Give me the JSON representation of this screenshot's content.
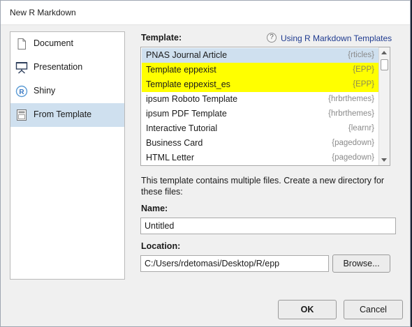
{
  "window": {
    "title": "New R Markdown"
  },
  "sidebar": {
    "items": [
      {
        "label": "Document",
        "icon": "document-icon",
        "selected": false
      },
      {
        "label": "Presentation",
        "icon": "presentation-icon",
        "selected": false
      },
      {
        "label": "Shiny",
        "icon": "shiny-icon",
        "selected": false
      },
      {
        "label": "From Template",
        "icon": "template-icon",
        "selected": true
      }
    ]
  },
  "template": {
    "label": "Template:",
    "help_link": "Using R Markdown Templates",
    "items": [
      {
        "name": "PNAS Journal Article",
        "package": "{rticles}",
        "state": "selected"
      },
      {
        "name": "Template eppexist",
        "package": "{EPP}",
        "state": "highlight"
      },
      {
        "name": "Template eppexist_es",
        "package": "{EPP}",
        "state": "highlight"
      },
      {
        "name": "ipsum Roboto Template",
        "package": "{hrbrthemes}",
        "state": "normal"
      },
      {
        "name": "ipsum PDF Template",
        "package": "{hrbrthemes}",
        "state": "normal"
      },
      {
        "name": "Interactive Tutorial",
        "package": "{learnr}",
        "state": "normal"
      },
      {
        "name": "Business Card",
        "package": "{pagedown}",
        "state": "normal"
      },
      {
        "name": "HTML Letter",
        "package": "{pagedown}",
        "state": "normal"
      }
    ]
  },
  "description": "This template contains multiple files. Create a new directory for these files:",
  "name_field": {
    "label": "Name:",
    "value": "Untitled"
  },
  "location_field": {
    "label": "Location:",
    "value": "C:/Users/rdetomasi/Desktop/R/epp",
    "browse_label": "Browse..."
  },
  "buttons": {
    "ok": "OK",
    "cancel": "Cancel"
  },
  "colors": {
    "selection": "#cfe0ef",
    "highlight": "#ffff00",
    "link": "#1e3a8f"
  }
}
